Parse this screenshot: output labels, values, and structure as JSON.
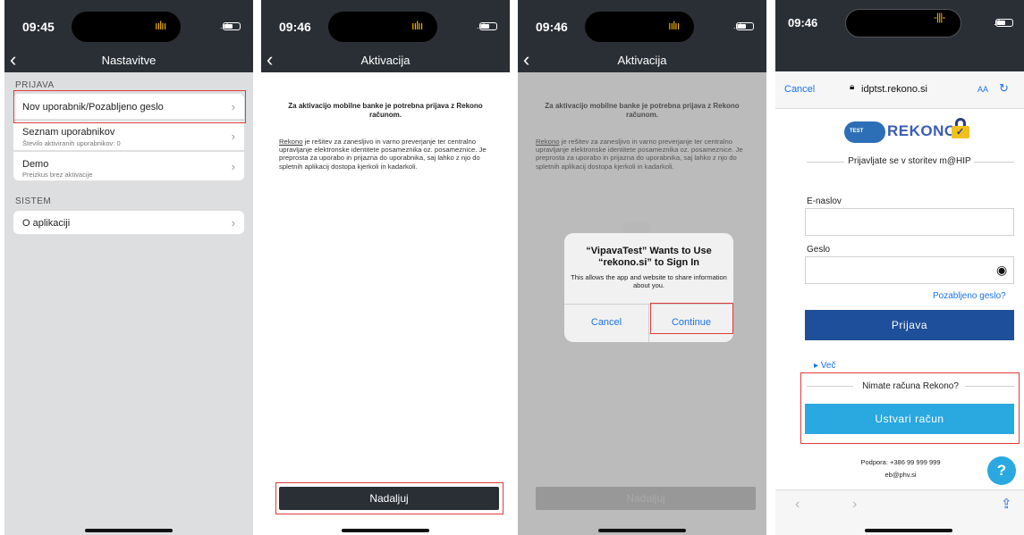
{
  "phones": [
    {
      "time": "09:45",
      "title": "Nastavitve",
      "sections": [
        {
          "label": "PRIJAVA",
          "items": [
            {
              "title": "Nov uporabnik/Pozabljeno geslo",
              "sub": ""
            },
            {
              "title": "Seznam uporabnikov",
              "sub": "Število aktiviranih uporabnikov: 0"
            },
            {
              "title": "Demo",
              "sub": "Preizkus brez aktivacije"
            }
          ]
        },
        {
          "label": "SISTEM",
          "items": [
            {
              "title": "O aplikaciji",
              "sub": ""
            }
          ]
        }
      ]
    },
    {
      "time": "09:46",
      "title": "Aktivacija",
      "heading": "Za aktivacijo mobilne banke je potrebna prijava z Rekono računom.",
      "para_link": "Rekono",
      "para_rest": " je rešitev za zanesljivo in varno preverjanje ter centralno upravljanje elektronske identitete posameznika oz. posameznice. Je preprosta za uporabo in prijazna do uporabnika, saj lahko z njo do spletnih aplikacij dostopa kjerkoli in kadarkoli.",
      "button": "Nadaljuj"
    },
    {
      "time": "09:46",
      "title": "Aktivacija",
      "heading": "Za aktivacijo mobilne banke je potrebna prijava z Rekono računom.",
      "para_link": "Rekono",
      "para_rest": " je rešitev za zanesljivo in varno preverjanje ter centralno upravljanje elektronske identitete posameznika oz. posameznice. Je preprosta za uporabo in prijazna do uporabnika, saj lahko z njo do spletnih aplikacij dostopa kjerkoli in kadarkoli.",
      "button": "Nadaljuj",
      "alert": {
        "title": "“VipavaTest” Wants to Use “rekono.si” to Sign In",
        "message": "This allows the app and website to share information about you.",
        "cancel": "Cancel",
        "continue": "Continue"
      }
    },
    {
      "time": "09:46",
      "browser": {
        "cancel": "Cancel",
        "url": "idptst.rekono.si",
        "aa": "AA"
      },
      "logo": {
        "badge": "TEST",
        "word": "REKONO"
      },
      "subtitle": "Prijavljate se v storitev m@HIP",
      "email_label": "E-naslov",
      "password_label": "Geslo",
      "forgot": "Pozabljeno geslo?",
      "login": "Prijava",
      "more": "▸ Več",
      "no_account": "Nimate računa Rekono?",
      "create": "Ustvari račun",
      "support_line1": "Podpora: +386 99 999 999",
      "support_line2": "eb@phv.si",
      "help": "?"
    }
  ],
  "icons": {
    "back": "back-chevron-icon",
    "chevron": "chevron-right-icon",
    "lock": "lock-icon",
    "reload": "reload-icon",
    "eye": "eye-icon",
    "help": "help-icon",
    "share": "share-icon"
  },
  "colors": {
    "header": "#2a2f36",
    "highlight": "#e03a3a",
    "primary": "#1e4f9a",
    "accent": "#2aa8e0",
    "link": "#1a73e8"
  }
}
